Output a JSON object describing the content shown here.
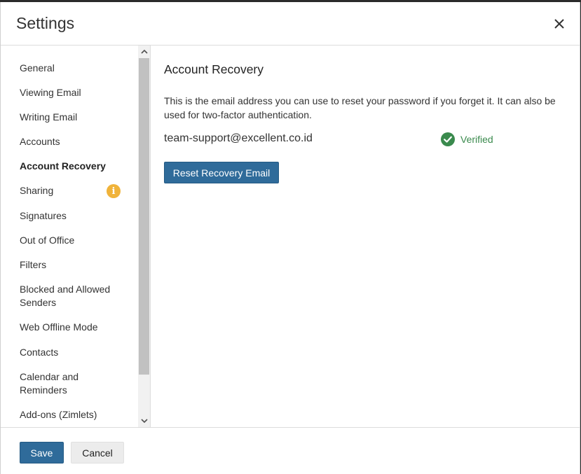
{
  "dialog": {
    "title": "Settings",
    "close_icon": "close-icon"
  },
  "sidebar": {
    "items": [
      {
        "label": "General"
      },
      {
        "label": "Viewing Email"
      },
      {
        "label": "Writing Email"
      },
      {
        "label": "Accounts"
      },
      {
        "label": "Account Recovery",
        "active": true
      },
      {
        "label": "Sharing",
        "badge_icon": "info-icon",
        "badge_text": "i",
        "badge_color": "#f0b33a"
      },
      {
        "label": "Signatures"
      },
      {
        "label": "Out of Office"
      },
      {
        "label": "Filters"
      },
      {
        "label": "Blocked and Allowed Senders"
      },
      {
        "label": "Web Offline Mode"
      },
      {
        "label": "Contacts"
      },
      {
        "label": "Calendar and Reminders"
      },
      {
        "label": "Add-ons (Zimlets)"
      }
    ]
  },
  "content": {
    "section_title": "Account Recovery",
    "description": "This is the email address you can use to reset your password if you forget it. It can also be used for two-factor authentication.",
    "email": "team-support@excellent.co.id",
    "status": {
      "label": "Verified",
      "icon": "check-circle-icon",
      "color": "#3a8a4d"
    },
    "reset_button_label": "Reset Recovery Email"
  },
  "footer": {
    "save_label": "Save",
    "cancel_label": "Cancel"
  },
  "colors": {
    "primary_button": "#2f6b9a",
    "badge": "#f0b33a",
    "verified": "#3a8a4d"
  }
}
